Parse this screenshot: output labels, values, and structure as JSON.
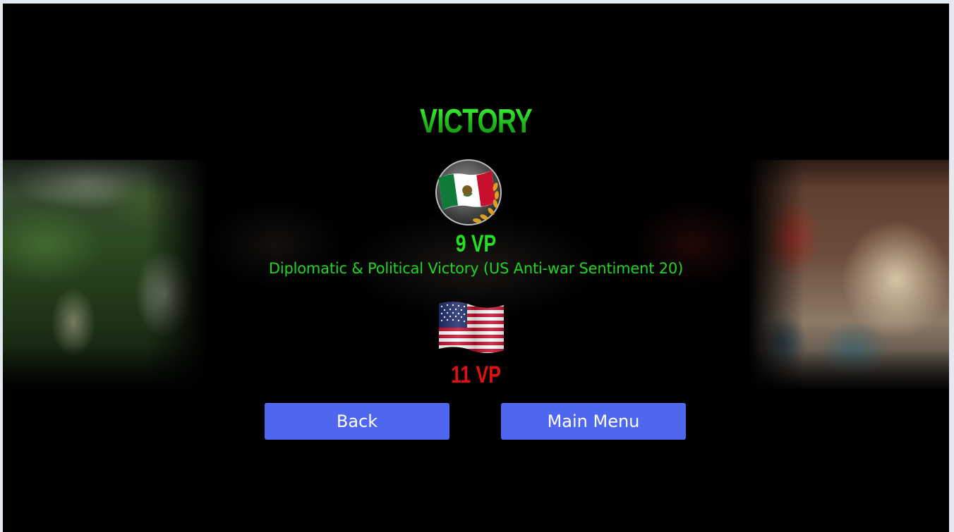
{
  "result": {
    "title": "VICTORY"
  },
  "mexico": {
    "vp": "9 VP",
    "victory_reason": "Diplomatic & Political Victory (US Anti-war Sentiment 20)",
    "icon": "mexico-flag-laurel-icon",
    "color": "#25e020"
  },
  "usa": {
    "vp": "11 VP",
    "icon": "usa-flag-icon",
    "color": "#e01010"
  },
  "buttons": {
    "back_label": "Back",
    "main_menu_label": "Main Menu",
    "color": "#4f67ee"
  }
}
